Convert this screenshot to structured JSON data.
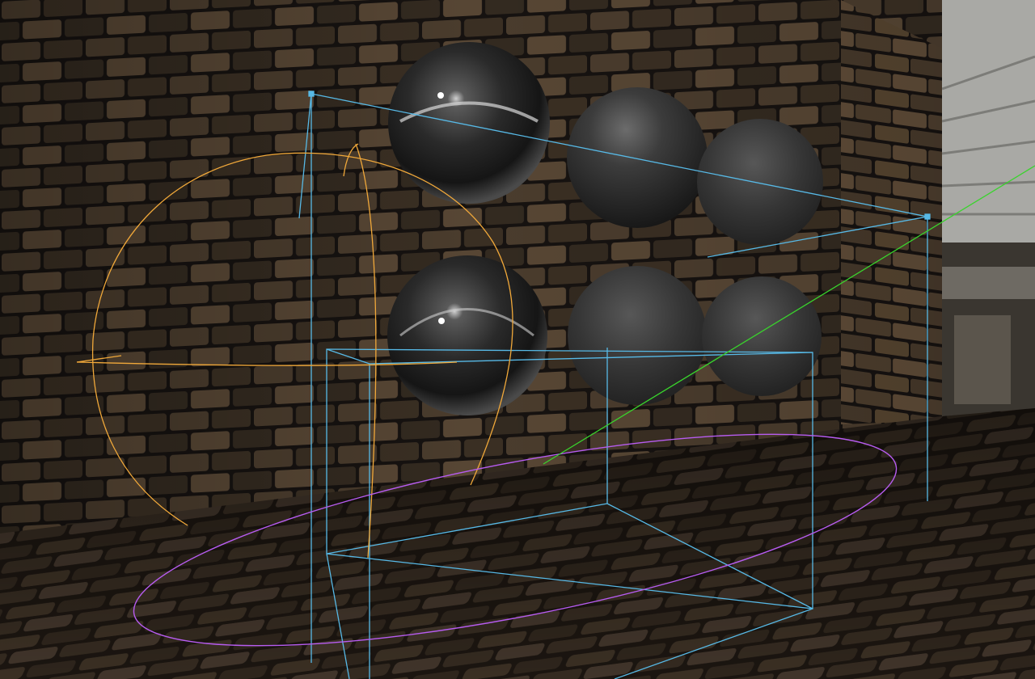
{
  "scene": {
    "colors": {
      "brick_dark": "#1f1912",
      "brick_mid": "#3b3024",
      "brick_light": "#5a4a38",
      "mortar": "#161210",
      "floor_dark": "#231c15",
      "floor_mid": "#3a2f23",
      "sphere_dark": "#1a1a1a",
      "sphere_mid": "#4a4a4a",
      "sphere_light": "#9a9a9a",
      "ceiling": "#b8b8b4",
      "gizmo_reflection_box": "#57b9e6",
      "gizmo_point_light": "#f0a83a",
      "gizmo_area_light": "#b75cf0",
      "gizmo_direction": "#39d42c"
    },
    "spheres": [
      {
        "kind": "chrome",
        "roughness": 0.05
      },
      {
        "kind": "matte",
        "roughness": 0.55
      },
      {
        "kind": "matte",
        "roughness": 0.75
      },
      {
        "kind": "chrome",
        "roughness": 0.15
      },
      {
        "kind": "matte",
        "roughness": 0.65
      },
      {
        "kind": "matte",
        "roughness": 0.85
      }
    ],
    "gizmos": [
      {
        "type": "reflection-probe-box",
        "color_key": "gizmo_reflection_box"
      },
      {
        "type": "point-light-range",
        "color_key": "gizmo_point_light"
      },
      {
        "type": "area-light-range",
        "color_key": "gizmo_area_light"
      },
      {
        "type": "direction-line",
        "color_key": "gizmo_direction"
      }
    ]
  }
}
